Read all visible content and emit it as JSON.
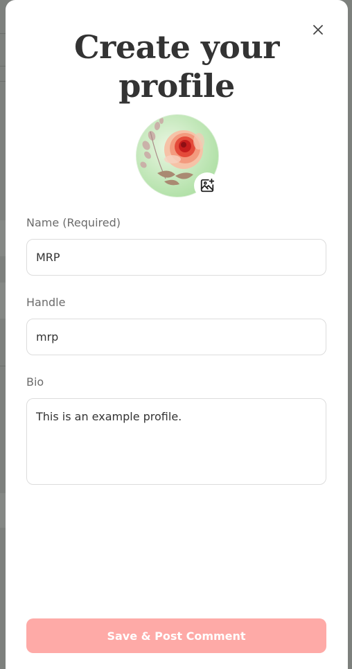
{
  "modal": {
    "title_line1": "Create your",
    "title_line2": "profile",
    "submit_label": "Save & Post Comment"
  },
  "form": {
    "name": {
      "label": "Name (Required)",
      "value": "MRP"
    },
    "handle": {
      "label": "Handle",
      "value": "mrp"
    },
    "bio": {
      "label": "Bio",
      "value": "This is an example profile."
    }
  },
  "icons": {
    "close": "close-icon",
    "avatar_edit": "image-plus-icon"
  },
  "colors": {
    "submit_bg": "#feaaa7",
    "title": "#333333",
    "backdrop": "#7d807d"
  }
}
